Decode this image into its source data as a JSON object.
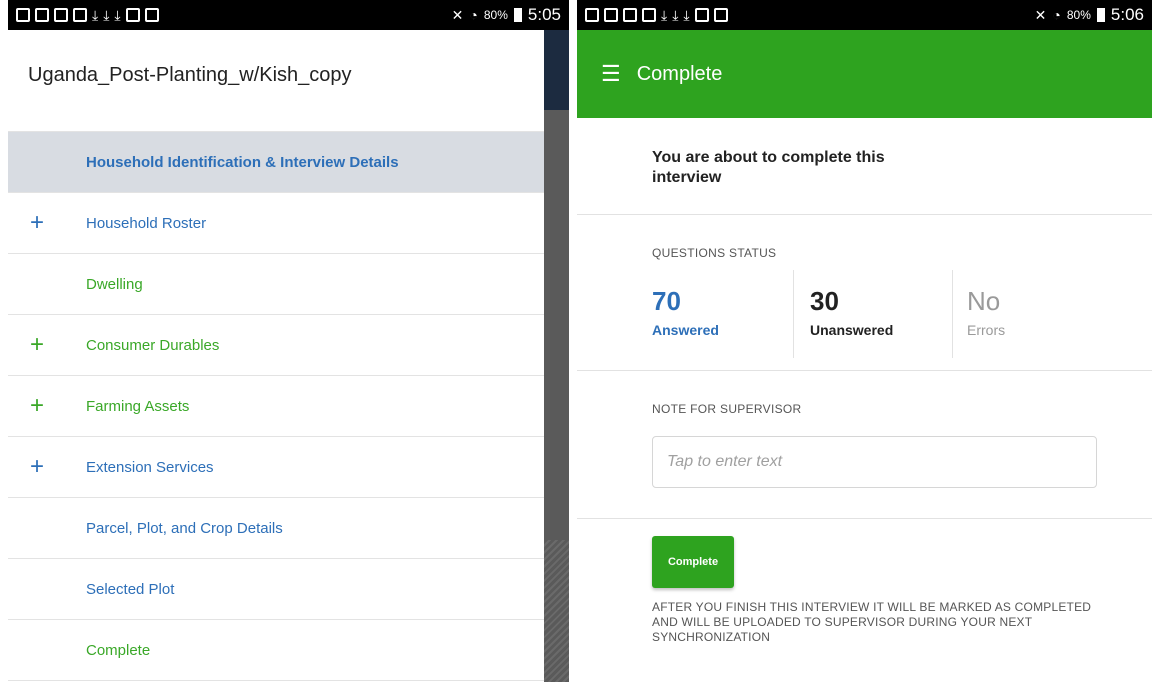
{
  "left": {
    "status": {
      "battery": "80%",
      "time": "5:05"
    },
    "drawer_title": "Uganda_Post-Planting_w/Kish_copy",
    "items": [
      {
        "label": "Household Identification & Interview Details",
        "plus": "",
        "color": "#2d6fb8"
      },
      {
        "label": "Household Roster",
        "plus": "+",
        "color": "#2d6fb8"
      },
      {
        "label": "Dwelling",
        "plus": "",
        "color": "#3aa828"
      },
      {
        "label": "Consumer Durables",
        "plus": "+",
        "color": "#3aa828"
      },
      {
        "label": "Farming Assets",
        "plus": "+",
        "color": "#3aa828"
      },
      {
        "label": "Extension Services",
        "plus": "+",
        "color": "#2d6fb8"
      },
      {
        "label": "Parcel, Plot, and Crop Details",
        "plus": "",
        "color": "#2d6fb8"
      },
      {
        "label": "Selected Plot",
        "plus": "",
        "color": "#2d6fb8"
      },
      {
        "label": "Complete",
        "plus": "",
        "color": "#3aa828"
      }
    ]
  },
  "right": {
    "status": {
      "battery": "80%",
      "time": "5:06"
    },
    "title": "Complete",
    "intro": "You are about to complete this interview",
    "questions_status_label": "QUESTIONS STATUS",
    "answered": {
      "value": "70",
      "label": "Answered"
    },
    "unanswered": {
      "value": "30",
      "label": "Unanswered"
    },
    "errors": {
      "value": "No",
      "label": "Errors"
    },
    "note_label": "NOTE FOR SUPERVISOR",
    "note_placeholder": "Tap to enter text",
    "complete_button": "Complete",
    "footnote": "AFTER YOU FINISH THIS INTERVIEW IT WILL BE MARKED AS COMPLETED AND WILL BE UPLOADED TO SUPERVISOR DURING YOUR NEXT SYNCHRONIZATION"
  },
  "colors": {
    "green": "#2ea31f",
    "blue": "#2d6fb8",
    "link_green": "#3aa828",
    "selected_bg": "#d8dce2"
  }
}
